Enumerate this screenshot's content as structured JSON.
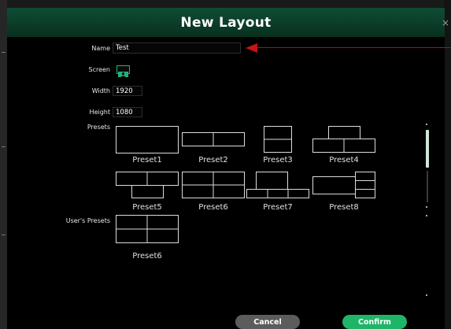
{
  "dialog": {
    "title": "New Layout",
    "close_glyph": "×"
  },
  "form": {
    "name_label": "Name",
    "name_value": "Test",
    "screen_label": "Screen",
    "screen_icon": "screen-user-icon",
    "width_label": "Width",
    "width_value": "1920",
    "height_label": "Height",
    "height_value": "1080"
  },
  "presets": {
    "label": "Presets",
    "items": [
      {
        "name": "Preset1"
      },
      {
        "name": "Preset2"
      },
      {
        "name": "Preset3"
      },
      {
        "name": "Preset4"
      },
      {
        "name": "Preset5"
      },
      {
        "name": "Preset6"
      },
      {
        "name": "Preset7"
      },
      {
        "name": "Preset8"
      }
    ]
  },
  "user_presets": {
    "label": "User's Presets",
    "items": [
      {
        "name": "Preset6"
      }
    ]
  },
  "buttons": {
    "cancel": "Cancel",
    "confirm": "Confirm"
  },
  "colors": {
    "accent": "#1fb569",
    "header_dark": "#0f4d35",
    "arrow": "#c81414"
  }
}
